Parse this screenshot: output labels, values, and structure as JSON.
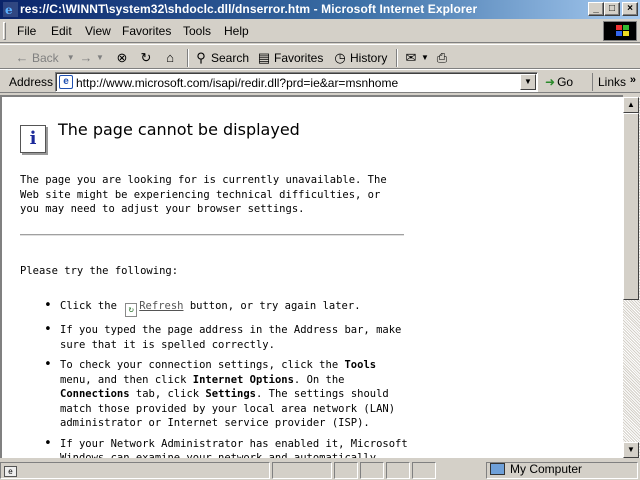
{
  "window": {
    "title": "res://C:\\WINNT\\system32\\shdoclc.dll/dnserror.htm - Microsoft Internet Explorer",
    "controls": {
      "minimize": "_",
      "maximize": "□",
      "close": "×"
    }
  },
  "menu": {
    "items": [
      "File",
      "Edit",
      "View",
      "Favorites",
      "Tools",
      "Help"
    ]
  },
  "toolbar": {
    "back": "Back",
    "forward_icon": "forward-arrow-icon",
    "stop_icon": "stop-icon",
    "refresh_icon": "refresh-icon",
    "home_icon": "home-icon",
    "search": "Search",
    "favorites": "Favorites",
    "history": "History"
  },
  "address": {
    "label": "Address",
    "url": "http://www.microsoft.com/isapi/redir.dll?prd=ie&ar=msnhome",
    "go": "Go",
    "links": "Links"
  },
  "page": {
    "heading": "The page cannot be displayed",
    "paragraph": "The page you are looking for is currently unavailable. The Web site might be experiencing technical difficulties, or you may need to adjust your browser settings.",
    "try_label": "Please try the following:",
    "bullet1_pre": "Click the",
    "bullet1_link": "Refresh",
    "bullet1_post": "button, or try again later.",
    "bullet2": "If you typed the page address in the Address bar, make sure that it is spelled correctly.",
    "bullet3_a": "To check your connection settings, click the",
    "bullet3_tools": "Tools",
    "bullet3_b": "menu, and then click",
    "bullet3_options": "Internet Options",
    "bullet3_c": ". On the",
    "bullet3_connections": "Connections",
    "bullet3_d": "tab, click",
    "bullet3_settings": "Settings",
    "bullet3_e": ". The settings should match those provided by your local area network (LAN) administrator or Internet service provider (ISP).",
    "bullet4": "If your Network Administrator has enabled it, Microsoft Windows can examine your network and automatically"
  },
  "status": {
    "zone": "My Computer"
  }
}
